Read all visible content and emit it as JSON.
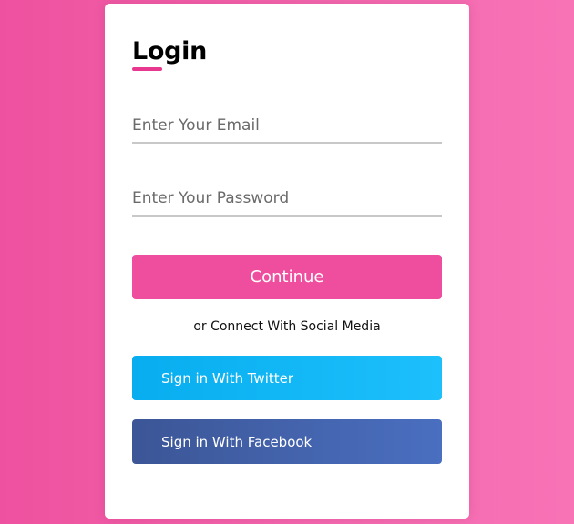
{
  "login": {
    "title": "Login",
    "email_placeholder": "Enter Your Email",
    "password_placeholder": "Enter Your Password",
    "continue_label": "Continue",
    "social_text": "or Connect With Social Media",
    "twitter_label": "Sign in With Twitter",
    "facebook_label": "Sign in With Facebook"
  },
  "colors": {
    "background": "#ee519f",
    "accent": "#e8378f",
    "continue_button": "#ee4e9d",
    "twitter_button": "#1dafef",
    "facebook_button": "#4462a8"
  }
}
